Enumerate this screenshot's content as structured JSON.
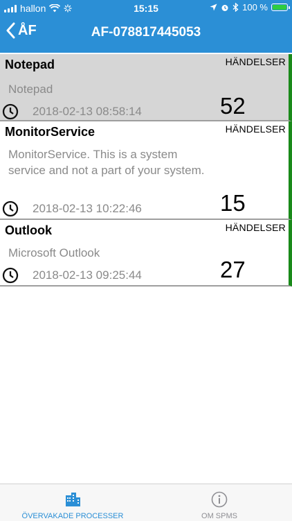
{
  "statusbar": {
    "carrier": "hallon",
    "time": "15:15",
    "battery": "100 %"
  },
  "navbar": {
    "back_label": "ÅF",
    "title": "AF-078817445053"
  },
  "events_label": "HÄNDELSER",
  "processes": [
    {
      "name": "Notepad",
      "description": "Notepad",
      "timestamp": "2018-02-13 08:58:14",
      "count": "52",
      "selected": true
    },
    {
      "name": "MonitorService",
      "description": "MonitorService. This is a system service and not a part of your system.",
      "timestamp": "2018-02-13 10:22:46",
      "count": "15",
      "selected": false
    },
    {
      "name": "Outlook",
      "description": "Microsoft Outlook",
      "timestamp": "2018-02-13 09:25:44",
      "count": "27",
      "selected": false
    }
  ],
  "tabs": [
    {
      "label": "ÖVERVAKADE PROCESSER",
      "icon": "buildings-icon",
      "active": true
    },
    {
      "label": "OM SPMS",
      "icon": "info-icon",
      "active": false
    }
  ],
  "colors": {
    "header": "#2b8fd6",
    "status_accent": "#1a8a1a",
    "active_tab": "#2b8fd6",
    "inactive_tab": "#8e8e93"
  }
}
